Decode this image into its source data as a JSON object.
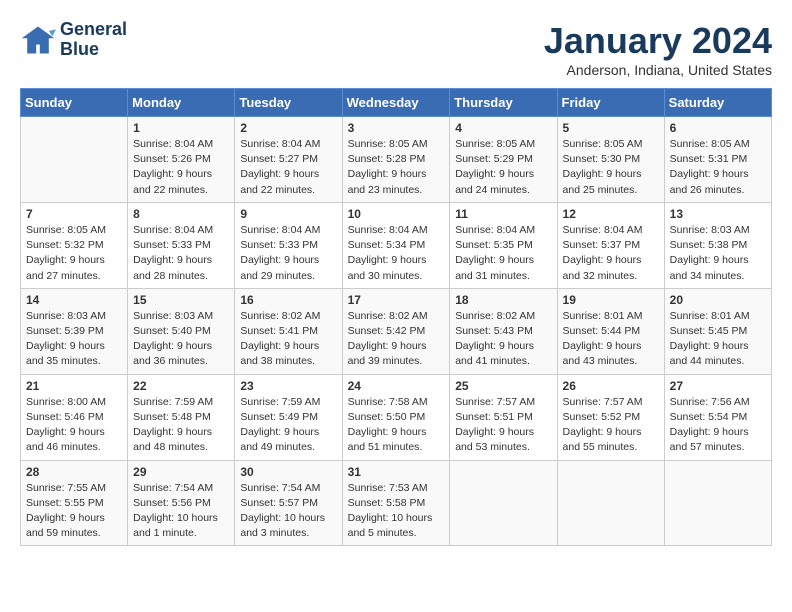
{
  "header": {
    "logo_line1": "General",
    "logo_line2": "Blue",
    "month": "January 2024",
    "location": "Anderson, Indiana, United States"
  },
  "days_of_week": [
    "Sunday",
    "Monday",
    "Tuesday",
    "Wednesday",
    "Thursday",
    "Friday",
    "Saturday"
  ],
  "weeks": [
    [
      {
        "day": "",
        "content": ""
      },
      {
        "day": "1",
        "content": "Sunrise: 8:04 AM\nSunset: 5:26 PM\nDaylight: 9 hours\nand 22 minutes."
      },
      {
        "day": "2",
        "content": "Sunrise: 8:04 AM\nSunset: 5:27 PM\nDaylight: 9 hours\nand 22 minutes."
      },
      {
        "day": "3",
        "content": "Sunrise: 8:05 AM\nSunset: 5:28 PM\nDaylight: 9 hours\nand 23 minutes."
      },
      {
        "day": "4",
        "content": "Sunrise: 8:05 AM\nSunset: 5:29 PM\nDaylight: 9 hours\nand 24 minutes."
      },
      {
        "day": "5",
        "content": "Sunrise: 8:05 AM\nSunset: 5:30 PM\nDaylight: 9 hours\nand 25 minutes."
      },
      {
        "day": "6",
        "content": "Sunrise: 8:05 AM\nSunset: 5:31 PM\nDaylight: 9 hours\nand 26 minutes."
      }
    ],
    [
      {
        "day": "7",
        "content": "Sunrise: 8:05 AM\nSunset: 5:32 PM\nDaylight: 9 hours\nand 27 minutes."
      },
      {
        "day": "8",
        "content": "Sunrise: 8:04 AM\nSunset: 5:33 PM\nDaylight: 9 hours\nand 28 minutes."
      },
      {
        "day": "9",
        "content": "Sunrise: 8:04 AM\nSunset: 5:33 PM\nDaylight: 9 hours\nand 29 minutes."
      },
      {
        "day": "10",
        "content": "Sunrise: 8:04 AM\nSunset: 5:34 PM\nDaylight: 9 hours\nand 30 minutes."
      },
      {
        "day": "11",
        "content": "Sunrise: 8:04 AM\nSunset: 5:35 PM\nDaylight: 9 hours\nand 31 minutes."
      },
      {
        "day": "12",
        "content": "Sunrise: 8:04 AM\nSunset: 5:37 PM\nDaylight: 9 hours\nand 32 minutes."
      },
      {
        "day": "13",
        "content": "Sunrise: 8:03 AM\nSunset: 5:38 PM\nDaylight: 9 hours\nand 34 minutes."
      }
    ],
    [
      {
        "day": "14",
        "content": "Sunrise: 8:03 AM\nSunset: 5:39 PM\nDaylight: 9 hours\nand 35 minutes."
      },
      {
        "day": "15",
        "content": "Sunrise: 8:03 AM\nSunset: 5:40 PM\nDaylight: 9 hours\nand 36 minutes."
      },
      {
        "day": "16",
        "content": "Sunrise: 8:02 AM\nSunset: 5:41 PM\nDaylight: 9 hours\nand 38 minutes."
      },
      {
        "day": "17",
        "content": "Sunrise: 8:02 AM\nSunset: 5:42 PM\nDaylight: 9 hours\nand 39 minutes."
      },
      {
        "day": "18",
        "content": "Sunrise: 8:02 AM\nSunset: 5:43 PM\nDaylight: 9 hours\nand 41 minutes."
      },
      {
        "day": "19",
        "content": "Sunrise: 8:01 AM\nSunset: 5:44 PM\nDaylight: 9 hours\nand 43 minutes."
      },
      {
        "day": "20",
        "content": "Sunrise: 8:01 AM\nSunset: 5:45 PM\nDaylight: 9 hours\nand 44 minutes."
      }
    ],
    [
      {
        "day": "21",
        "content": "Sunrise: 8:00 AM\nSunset: 5:46 PM\nDaylight: 9 hours\nand 46 minutes."
      },
      {
        "day": "22",
        "content": "Sunrise: 7:59 AM\nSunset: 5:48 PM\nDaylight: 9 hours\nand 48 minutes."
      },
      {
        "day": "23",
        "content": "Sunrise: 7:59 AM\nSunset: 5:49 PM\nDaylight: 9 hours\nand 49 minutes."
      },
      {
        "day": "24",
        "content": "Sunrise: 7:58 AM\nSunset: 5:50 PM\nDaylight: 9 hours\nand 51 minutes."
      },
      {
        "day": "25",
        "content": "Sunrise: 7:57 AM\nSunset: 5:51 PM\nDaylight: 9 hours\nand 53 minutes."
      },
      {
        "day": "26",
        "content": "Sunrise: 7:57 AM\nSunset: 5:52 PM\nDaylight: 9 hours\nand 55 minutes."
      },
      {
        "day": "27",
        "content": "Sunrise: 7:56 AM\nSunset: 5:54 PM\nDaylight: 9 hours\nand 57 minutes."
      }
    ],
    [
      {
        "day": "28",
        "content": "Sunrise: 7:55 AM\nSunset: 5:55 PM\nDaylight: 9 hours\nand 59 minutes."
      },
      {
        "day": "29",
        "content": "Sunrise: 7:54 AM\nSunset: 5:56 PM\nDaylight: 10 hours\nand 1 minute."
      },
      {
        "day": "30",
        "content": "Sunrise: 7:54 AM\nSunset: 5:57 PM\nDaylight: 10 hours\nand 3 minutes."
      },
      {
        "day": "31",
        "content": "Sunrise: 7:53 AM\nSunset: 5:58 PM\nDaylight: 10 hours\nand 5 minutes."
      },
      {
        "day": "",
        "content": ""
      },
      {
        "day": "",
        "content": ""
      },
      {
        "day": "",
        "content": ""
      }
    ]
  ]
}
